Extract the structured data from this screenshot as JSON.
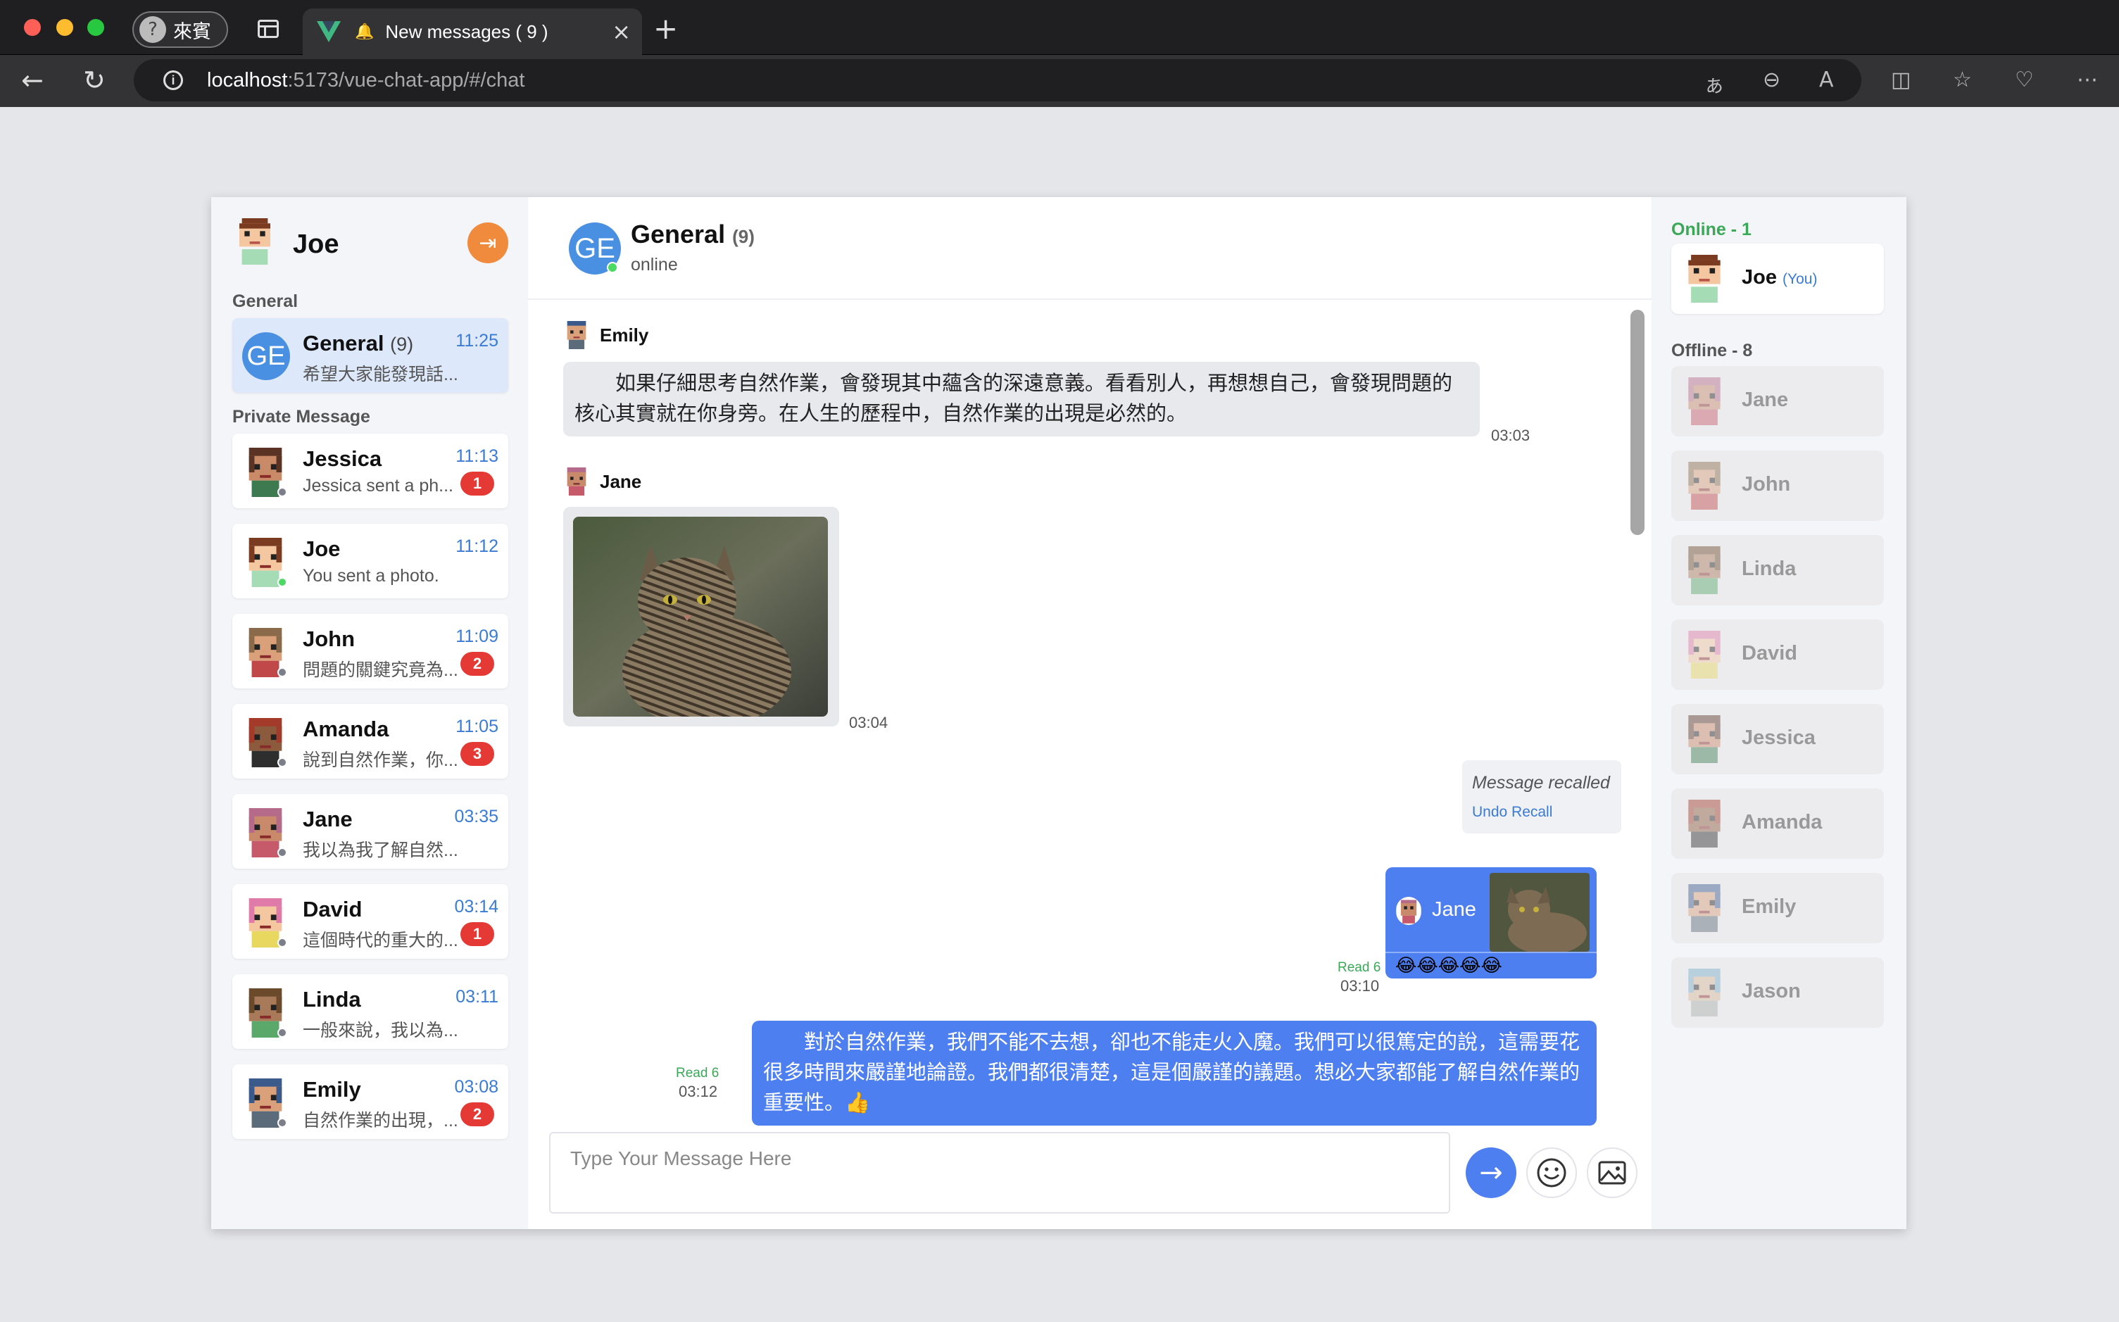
{
  "browser": {
    "profile_label": "來賓",
    "tab_title": "New messages ( 9 )",
    "url_host": "localhost",
    "url_rest": ":5173/vue-chat-app/#/chat"
  },
  "me": {
    "name": "Joe"
  },
  "sidebar": {
    "group_label": "General",
    "private_label": "Private Message",
    "general": {
      "avatar_text": "GE",
      "name": "General",
      "count": "(9)",
      "time": "11:25",
      "preview": "希望大家能發現話..."
    },
    "conversations": [
      {
        "name": "Jessica",
        "time": "11:13",
        "preview": "Jessica sent a ph...",
        "badge": "1"
      },
      {
        "name": "Joe",
        "time": "11:12",
        "preview": "You sent a photo.",
        "badge": ""
      },
      {
        "name": "John",
        "time": "11:09",
        "preview": "問題的關鍵究竟為...",
        "badge": "2"
      },
      {
        "name": "Amanda",
        "time": "11:05",
        "preview": "說到自然作業，你...",
        "badge": "3"
      },
      {
        "name": "Jane",
        "time": "03:35",
        "preview": "我以為我了解自然...",
        "badge": ""
      },
      {
        "name": "David",
        "time": "03:14",
        "preview": "這個時代的重大的...",
        "badge": "1"
      },
      {
        "name": "Linda",
        "time": "03:11",
        "preview": "一般來說，我以為...",
        "badge": ""
      },
      {
        "name": "Emily",
        "time": "03:08",
        "preview": "自然作業的出現，...",
        "badge": "2"
      }
    ]
  },
  "chat": {
    "avatar_text": "GE",
    "title": "General",
    "count": "(9)",
    "status": "online",
    "messages": {
      "emily": {
        "sender": "Emily",
        "text": "　　如果仔細思考自然作業，會發現其中蘊含的深遠意義。看看別人，再想想自己，會發現問題的核心其實就在你身旁。在人生的歷程中，自然作業的出現是必然的。",
        "time": "03:03"
      },
      "jane_photo": {
        "sender": "Jane",
        "time": "03:04"
      },
      "recalled": {
        "text": "Message recalled",
        "undo": "Undo Recall"
      },
      "reply": {
        "quoted_sender": "Jane",
        "text": "😂😂😂😂😂",
        "read": "Read 6",
        "time": "03:10"
      },
      "own": {
        "text": "　　對於自然作業，我們不能不去想，卻也不能走火入魔。我們可以很篤定的說，這需要花很多時間來嚴謹地論證。我們都很清楚，這是個嚴謹的議題。想必大家都能了解自然作業的重要性。👍",
        "read": "Read 6",
        "time": "03:12"
      }
    },
    "composer_placeholder": "Type Your Message Here"
  },
  "members": {
    "online_label": "Online - 1",
    "offline_label": "Offline - 8",
    "online": [
      {
        "name": "Joe",
        "tag": "(You)"
      }
    ],
    "offline": [
      "Jane",
      "John",
      "Linda",
      "David",
      "Jessica",
      "Amanda",
      "Emily",
      "Jason"
    ]
  },
  "colors": {
    "accent": "#4e7ff0",
    "online": "#4cd964",
    "badge": "#e53935",
    "logout": "#f08a3c"
  }
}
